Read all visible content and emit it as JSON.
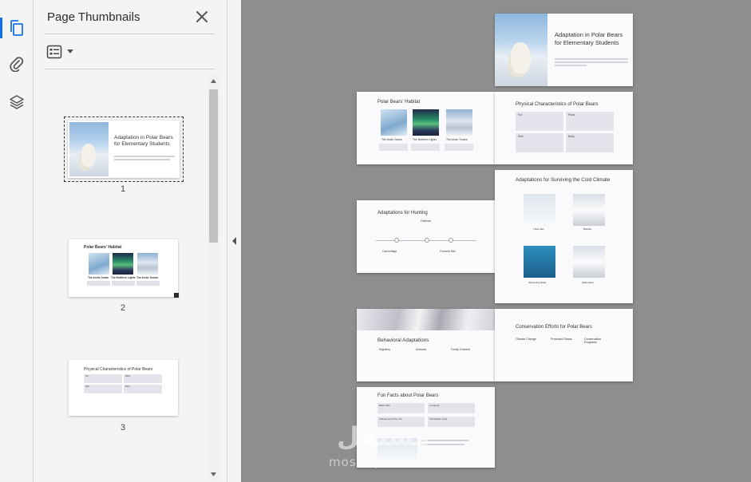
{
  "panel": {
    "title": "Page Thumbnails"
  },
  "icons": {
    "thumbnails": "pages-icon",
    "attachments": "paperclip-icon",
    "layers": "layers-icon",
    "close": "close-icon",
    "options": "thumbnail-options-icon"
  },
  "colors": {
    "accent": "#1473e6",
    "doc_background": "#8e8e8e",
    "panel_background": "#f4f4f4"
  },
  "thumbnails": [
    {
      "page": "1",
      "title": "Adaptation in Polar Bears for Elementary Students"
    },
    {
      "page": "2",
      "title": "Polar Bears' Habitat",
      "captions": [
        "The Arctic Ocean",
        "The Northern Lights",
        "The Arctic Tundra"
      ]
    },
    {
      "page": "3",
      "title": "Physical Characteristics of Polar Bears",
      "cells": [
        "Fur",
        "Paws",
        "Skin",
        "Body"
      ]
    }
  ],
  "slides": {
    "s1": {
      "title": "Adaptation in Polar Bears for Elementary Students"
    },
    "s2": {
      "title": "Polar Bears' Habitat",
      "captions": [
        "The Arctic Ocean",
        "The Northern Lights",
        "The Arctic Tundra"
      ]
    },
    "s3": {
      "title": "Physical Characteristics of Polar Bears",
      "cells": [
        "Fur",
        "Paws",
        "Skin",
        "Body"
      ]
    },
    "s4": {
      "title": "Adaptations for Hunting",
      "labels": [
        "Patience",
        "Camouflage",
        "Powerful Bite"
      ]
    },
    "s5": {
      "title": "Adaptations for Surviving the Cold Climate",
      "captions": [
        "Thick Skin",
        "Blubber",
        "Swimming Ability",
        "Hibernation"
      ]
    },
    "s6": {
      "title": "Behavioral Adaptations",
      "items": [
        "Migratory",
        "Nomadic",
        "Family Oriented"
      ]
    },
    "s7": {
      "title": "Conservation Efforts for Polar Bears",
      "columns": [
        "Climate Change",
        "Protected Status",
        "Conservation Programs"
      ]
    },
    "s8": {
      "title": "Fun Facts about Polar Bears",
      "cells": [
        "Black Skin",
        "Longevity",
        "Athletes and Prey Tro",
        "Vulnerable Cubs"
      ]
    }
  },
  "watermark": {
    "line1": "مستقل",
    "line2": "mostaql.com"
  }
}
